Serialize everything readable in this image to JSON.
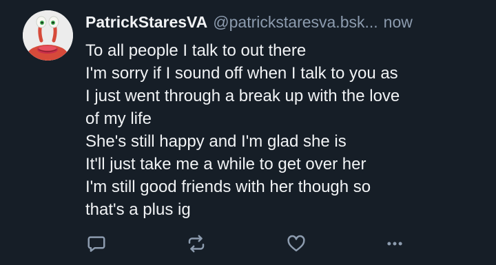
{
  "post": {
    "author": {
      "display_name": "PatrickStaresVA",
      "handle": "@patrickstaresva.bsk...",
      "avatar_icon": "crab-character-avatar"
    },
    "timestamp": "now",
    "text_lines": [
      "To all people I talk to out there",
      "I'm sorry if I sound off when I talk to you as",
      "I just went through a break up with the love",
      "of my life",
      "She's still happy and I'm glad she is",
      "It'll just take me a while to get over her",
      "I'm still good friends with her though so",
      "that's a plus ig"
    ],
    "actions": [
      {
        "name": "reply",
        "icon": "speech-bubble-icon"
      },
      {
        "name": "repost",
        "icon": "repost-arrows-icon"
      },
      {
        "name": "like",
        "icon": "heart-icon"
      },
      {
        "name": "more",
        "icon": "ellipsis-icon"
      }
    ]
  },
  "colors": {
    "background": "#161e27",
    "text_primary": "#f1f3f5",
    "text_secondary": "#8d9caf",
    "icon": "#8d9caf"
  }
}
